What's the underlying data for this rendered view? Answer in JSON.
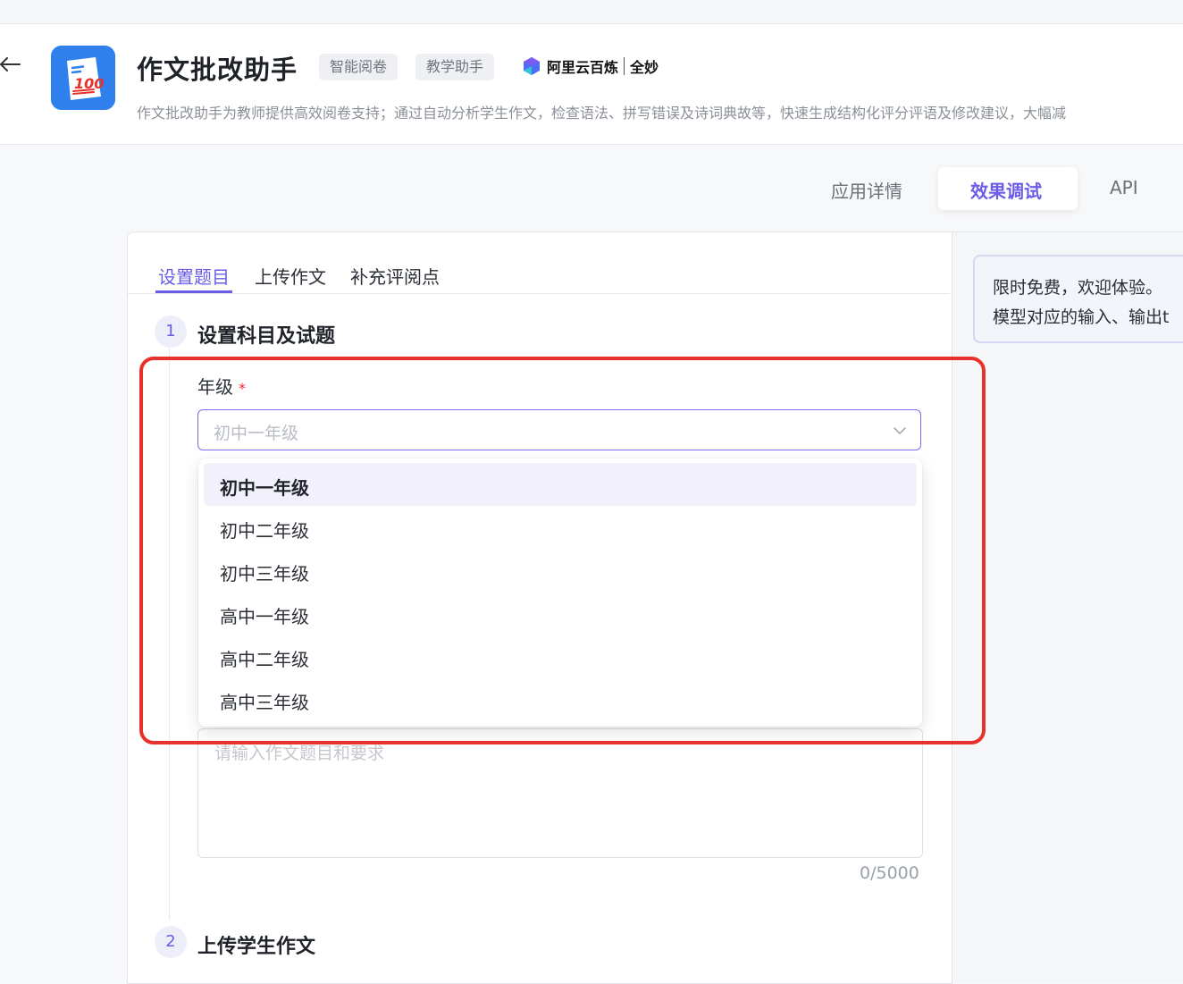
{
  "app": {
    "title": "作文批改助手",
    "tags": [
      "智能阅卷",
      "教学助手"
    ],
    "brand": {
      "name": "阿里云百炼",
      "product": "全妙"
    },
    "description": "作文批改助手为教师提供高效阅卷支持；通过自动分析学生作文，检查语法、拼写错误及诗词典故等，快速生成结构化评分评语及修改建议，大幅减"
  },
  "tabs": [
    {
      "label": "应用详情",
      "active": false
    },
    {
      "label": "效果调试",
      "active": true
    },
    {
      "label": "API",
      "active": false
    }
  ],
  "notice": {
    "line1": "限时免费，欢迎体验。",
    "line2": "模型对应的输入、输出t"
  },
  "subtabs": [
    {
      "label": "设置题目",
      "active": true
    },
    {
      "label": "上传作文",
      "active": false
    },
    {
      "label": "补充评阅点",
      "active": false
    }
  ],
  "steps": [
    {
      "number": "1",
      "title": "设置科目及试题"
    },
    {
      "number": "2",
      "title": "上传学生作文"
    }
  ],
  "grade_field": {
    "label": "年级",
    "required_mark": "*",
    "placeholder": "初中一年级",
    "options": [
      "初中一年级",
      "初中二年级",
      "初中三年级",
      "高中一年级",
      "高中二年级",
      "高中三年级"
    ],
    "selected": "初中一年级"
  },
  "topic_field": {
    "placeholder": "请输入作文题目和要求",
    "counter": "0/5000"
  },
  "colors": {
    "accent": "#6b5ce7",
    "highlight": "#e8312a",
    "logo_blue": "#2f80ed"
  }
}
